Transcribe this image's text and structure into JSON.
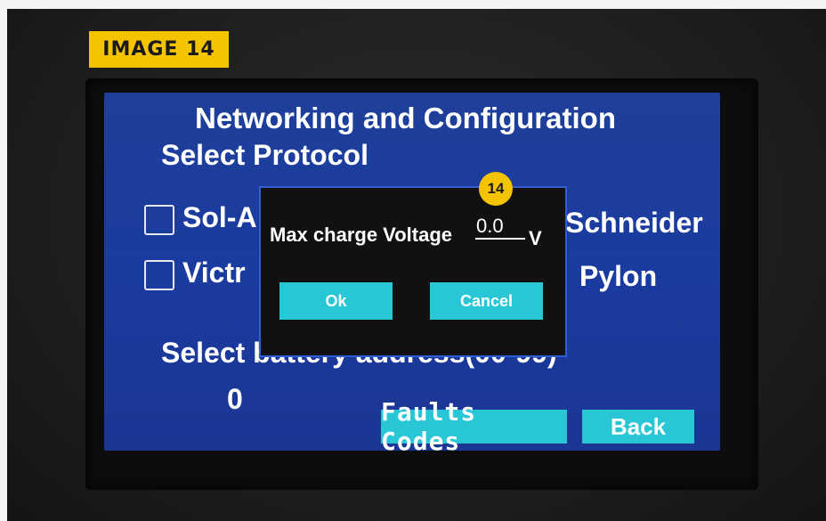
{
  "overlay": {
    "image_tag": "IMAGE 14",
    "marker_number": "14"
  },
  "screen": {
    "title": "Networking and Configuration",
    "protocol_label": "Select Protocol",
    "protocol_options": [
      {
        "label": "Sol-A",
        "checked": false
      },
      {
        "label": "Schneider",
        "checked": false
      },
      {
        "label": "Victr",
        "checked": false
      },
      {
        "label": "Pylon",
        "checked": false
      }
    ],
    "address_label": "Select battery address(00-99)",
    "address_value": "0",
    "faults_button": "Faults Codes",
    "back_button": "Back"
  },
  "dialog": {
    "label": "Max charge Voltage",
    "value": "0.0",
    "unit": "V",
    "ok_button": "Ok",
    "cancel_button": "Cancel"
  },
  "colors": {
    "screen_bg": "#1b3a9c",
    "button_bg": "#29c6d6",
    "dialog_bg": "#111111",
    "dialog_border": "#2f5fd0",
    "tag_bg": "#f5c400"
  }
}
